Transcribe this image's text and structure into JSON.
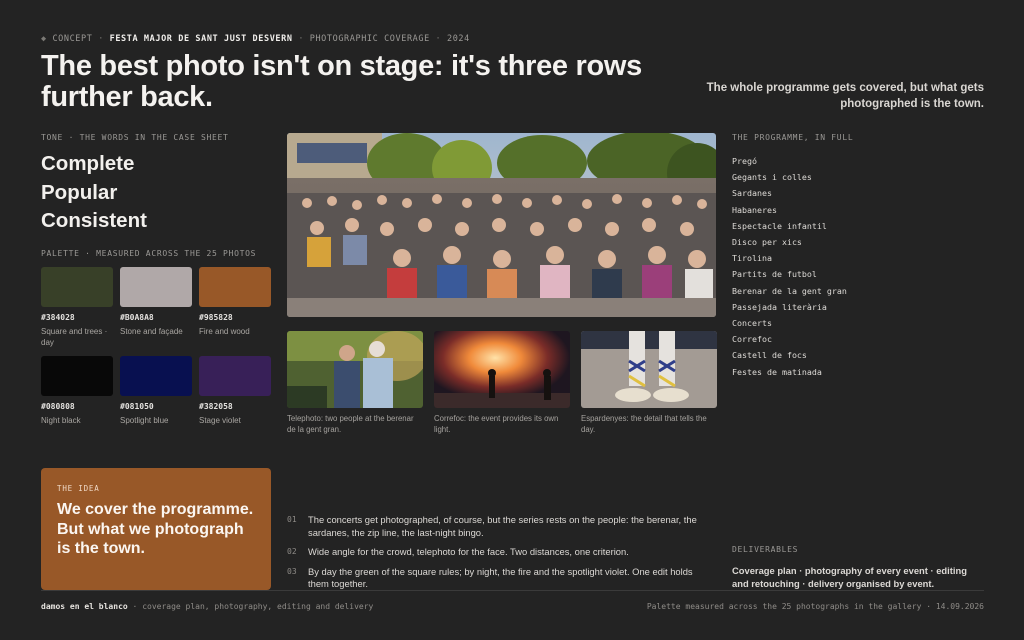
{
  "header": {
    "eyebrow_bullet": "◆",
    "eyebrow_section": "CONCEPT",
    "eyebrow_sep": "·",
    "eyebrow_project": "FESTA MAJOR DE SANT JUST DESVERN",
    "eyebrow_type": "PHOTOGRAPHIC COVERAGE",
    "eyebrow_year": "2024",
    "headline": "The best photo isn't on stage: it's three rows further back.",
    "tagline": "The whole programme gets covered, but what gets photographed is the town."
  },
  "tone": {
    "label": "TONE · THE WORDS IN THE CASE SHEET",
    "words": [
      "Complete",
      "Popular",
      "Consistent"
    ]
  },
  "palette": {
    "label": "PALETTE · MEASURED ACROSS THE 25 PHOTOS",
    "swatches": [
      {
        "hex": "#384028",
        "color": "#384028",
        "name": "Square and trees · day"
      },
      {
        "hex": "#B0A8A8",
        "color": "#B0A8A8",
        "name": "Stone and façade"
      },
      {
        "hex": "#985828",
        "color": "#985828",
        "name": "Fire and wood"
      },
      {
        "hex": "#080808",
        "color": "#080808",
        "name": "Night black"
      },
      {
        "hex": "#081050",
        "color": "#081050",
        "name": "Spotlight blue"
      },
      {
        "hex": "#382058",
        "color": "#382058",
        "name": "Stage violet"
      }
    ]
  },
  "photos": {
    "captions": [
      "Telephoto: two people at the berenar de la gent gran.",
      "Correfoc: the event provides its own light.",
      "Espardenyes: the detail that tells the day."
    ]
  },
  "programme": {
    "label": "THE PROGRAMME, IN FULL",
    "items": [
      "Pregó",
      "Gegants i colles",
      "Sardanes",
      "Habaneres",
      "Espectacle infantil",
      "Disco per xics",
      "Tirolina",
      "Partits de futbol",
      "Berenar de la gent gran",
      "Passejada literària",
      "Concerts",
      "Correfoc",
      "Castell de focs",
      "Festes de matinada"
    ]
  },
  "idea": {
    "label": "THE IDEA",
    "text": "We cover the programme. But what we photograph is the town."
  },
  "points": [
    {
      "num": "01",
      "text": "The concerts get photographed, of course, but the series rests on the people: the berenar, the sardanes, the zip line, the last-night bingo."
    },
    {
      "num": "02",
      "text": "Wide angle for the crowd, telephoto for the face. Two distances, one criterion."
    },
    {
      "num": "03",
      "text": "By day the green of the square rules; by night, the fire and the spotlight violet. One edit holds them together."
    }
  ],
  "deliverables": {
    "label": "DELIVERABLES",
    "text": "Coverage plan · photography of every event · editing and retouching · delivery organised by event."
  },
  "footer": {
    "studio": "damos en el blanco",
    "sep": "·",
    "services": "coverage plan, photography, editing and delivery",
    "right": "Palette measured across the 25 photographs in the gallery · 14.09.2026"
  }
}
